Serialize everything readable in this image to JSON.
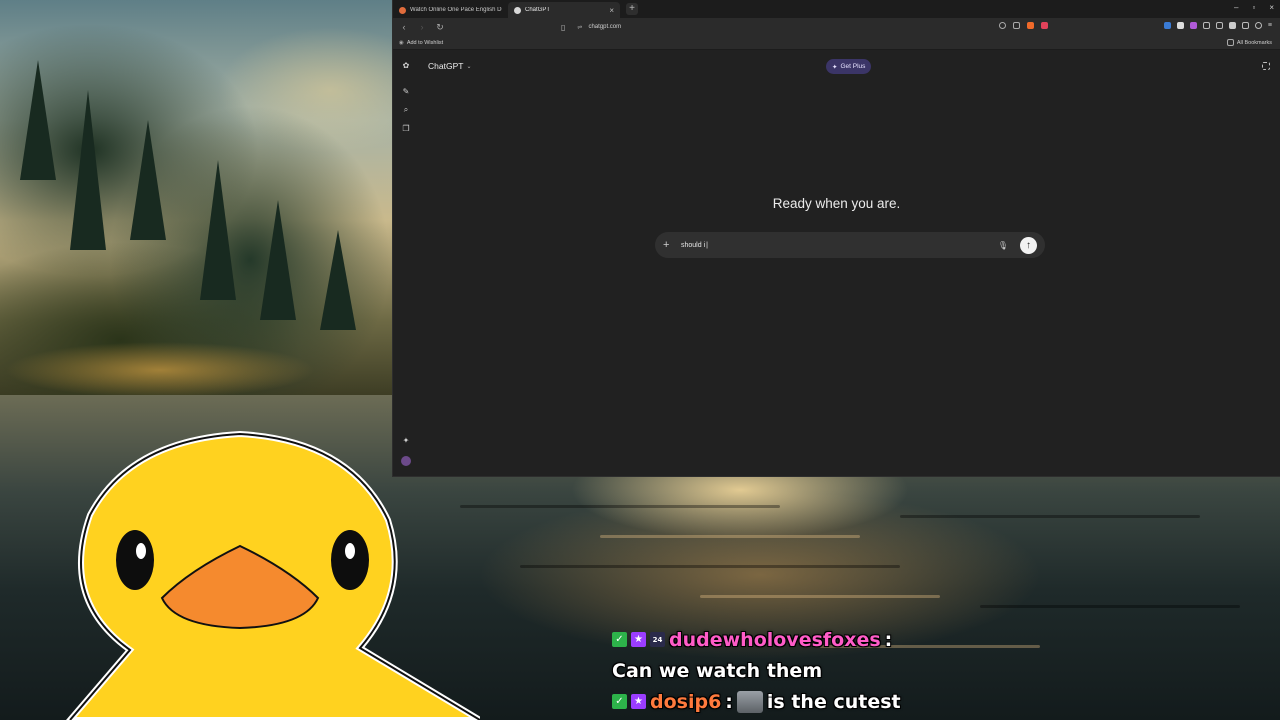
{
  "browser": {
    "tabs": [
      {
        "label": "Watch Online One Pace English Dub",
        "active": false,
        "favicon_color": "#e06c3c"
      },
      {
        "label": "ChatGPT",
        "active": true,
        "favicon_color": "#d8d8d8"
      }
    ],
    "new_tab_label": "+",
    "tab_close_label": "×",
    "window_controls": {
      "minimize": "–",
      "maximize": "▫",
      "close": "×"
    },
    "address": "chatgpt.com",
    "bookmarks_bar": {
      "add_to_wishlist": "Add to Wishlist",
      "all_bookmarks": "All Bookmarks"
    }
  },
  "chatgpt": {
    "model_label": "ChatGPT",
    "get_plus_label": "Get Plus",
    "hero_heading": "Ready when you are.",
    "composer": {
      "value": "should i",
      "plus_label": "+",
      "send_label": "↑"
    }
  },
  "chat_overlay": {
    "messages": [
      {
        "username": "dudewholovesfoxes",
        "username_color": "#ff5cc8",
        "badges": [
          "mod",
          "vip",
          "sub"
        ],
        "text": "",
        "separator": ":"
      },
      {
        "username": "",
        "username_color": "",
        "badges": [],
        "text": "Can we watch them",
        "separator": ""
      },
      {
        "username": "dosip6",
        "username_color": "#ff7a3d",
        "badges": [
          "mod",
          "vip"
        ],
        "text": "is the cutest",
        "separator": ":",
        "emote": true
      }
    ]
  },
  "colors": {
    "browser_bg": "#212121",
    "get_plus_bg": "#3b3567",
    "duck_yellow": "#ffd21f",
    "duck_beak": "#f58a2e"
  }
}
